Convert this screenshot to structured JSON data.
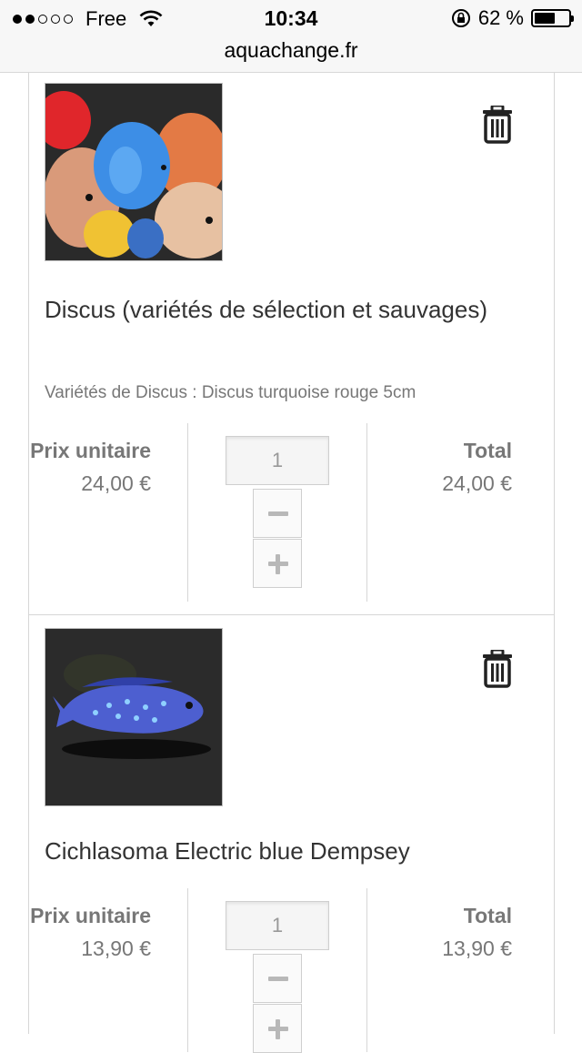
{
  "status_bar": {
    "carrier": "Free",
    "time": "10:34",
    "battery": "62 %",
    "battery_level": 0.62,
    "signal_bars_filled": 2,
    "signal_bars_total": 5,
    "icons": [
      "wifi-icon",
      "rotation-lock-icon",
      "battery-icon"
    ]
  },
  "browser": {
    "url": "aquachange.fr"
  },
  "cart": {
    "items": [
      {
        "name": "Discus (variétés de sélection et sauvages)",
        "variant": "Variétés de Discus : Discus turquoise rouge 5cm",
        "unit_price_label": "Prix unitaire",
        "unit_price": "24,00 €",
        "quantity": "1",
        "total_label": "Total",
        "total": "24,00 €",
        "image": "discus-fish-photo"
      },
      {
        "name": "Cichlasoma Electric blue Dempsey",
        "unit_price_label": "Prix unitaire",
        "unit_price": "13,90 €",
        "quantity": "1",
        "total_label": "Total",
        "total": "13,90 €",
        "image": "electric-blue-dempsey-photo"
      }
    ]
  },
  "colors": {
    "label_gray": "#777777",
    "border": "#d6d6d6",
    "statusbar_bg": "#f7f7f7"
  }
}
